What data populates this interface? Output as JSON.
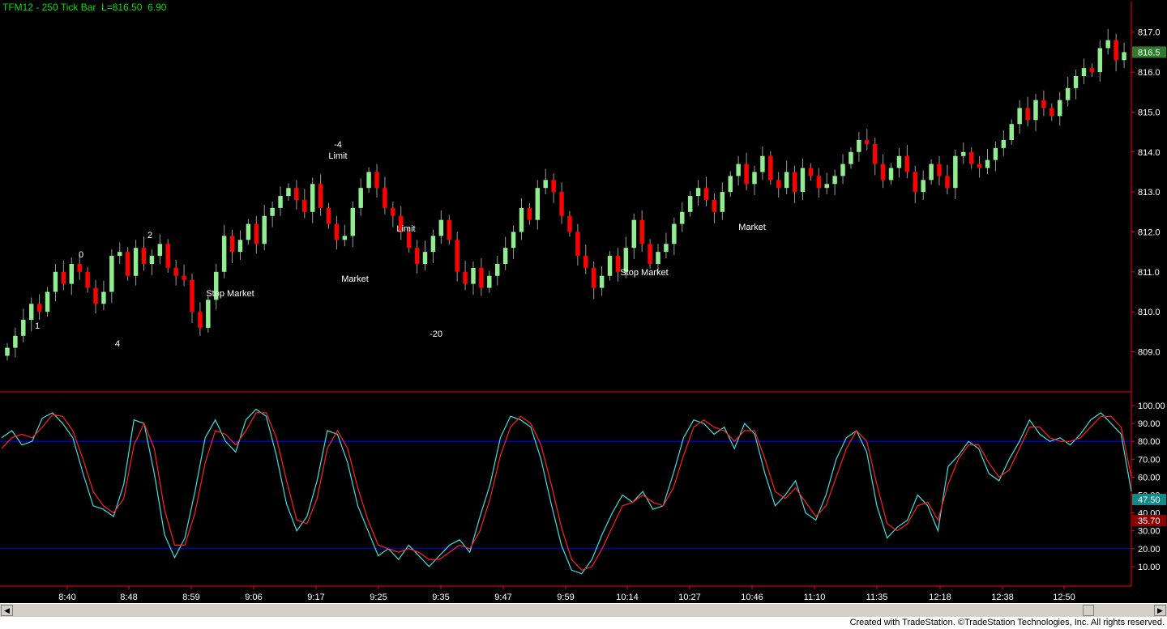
{
  "header": {
    "symbol": "TFM12 - 250 Tick Bar",
    "last_label": "L=816.50",
    "change": "6.90"
  },
  "footer": {
    "text": "Created with TradeStation. ©TradeStation Technologies, Inc. All rights reserved."
  },
  "colors": {
    "up_bar": "#90ee90",
    "down_bar": "#ff0000",
    "fast_line": "#40e0e0",
    "slow_line": "#ff2020",
    "axis": "#ff0000",
    "band": "#0000ff",
    "price_label_bg": "#2e7d2e",
    "osc_fast_bg": "#138a8a",
    "osc_slow_bg": "#8b0000"
  },
  "chart_data": [
    {
      "type": "candlestick",
      "y_ticks": [
        "809.0",
        "810.0",
        "811.0",
        "812.0",
        "813.0",
        "814.0",
        "815.0",
        "816.0",
        "817.0"
      ],
      "ylim": [
        808.2,
        817.4
      ],
      "last_price_label": "816.5",
      "close_series": [
        809.1,
        809.4,
        809.8,
        810.2,
        810.0,
        810.5,
        811.0,
        810.7,
        811.2,
        811.0,
        810.6,
        810.2,
        810.5,
        811.4,
        811.5,
        810.9,
        811.6,
        811.2,
        811.4,
        811.7,
        811.1,
        810.9,
        810.8,
        810.0,
        809.6,
        810.3,
        811.0,
        811.9,
        811.5,
        811.8,
        812.2,
        811.7,
        812.4,
        812.6,
        812.9,
        813.1,
        812.8,
        812.5,
        813.2,
        812.6,
        812.2,
        811.8,
        811.9,
        812.6,
        813.1,
        813.5,
        813.1,
        812.6,
        812.4,
        812.0,
        811.6,
        811.2,
        811.5,
        811.9,
        812.3,
        811.8,
        811.0,
        810.7,
        811.1,
        810.6,
        810.9,
        811.2,
        811.6,
        812.0,
        812.6,
        812.3,
        813.1,
        813.3,
        813.0,
        812.4,
        812.0,
        811.4,
        811.1,
        810.6,
        810.9,
        811.4,
        811.0,
        811.6,
        812.3,
        811.7,
        811.2,
        811.5,
        811.7,
        812.2,
        812.5,
        812.9,
        813.1,
        812.8,
        812.5,
        813.0,
        813.4,
        813.7,
        813.2,
        813.5,
        813.9,
        813.3,
        813.1,
        813.5,
        813.0,
        813.6,
        813.4,
        813.1,
        813.2,
        813.4,
        813.7,
        814.0,
        814.3,
        814.2,
        813.7,
        813.3,
        813.6,
        813.9,
        813.5,
        813.0,
        813.3,
        813.7,
        813.4,
        813.1,
        813.9,
        814.0,
        813.7,
        813.6,
        813.8,
        814.1,
        814.3,
        814.7,
        815.1,
        814.8,
        815.3,
        815.1,
        814.9,
        815.3,
        815.6,
        815.9,
        816.1,
        816.0,
        816.6,
        816.8,
        816.3,
        816.5
      ],
      "annotations": [
        "0",
        "1",
        "2",
        "4",
        "-4",
        "Limit",
        "Stop Market",
        "Market",
        "Limit",
        "Stop Market",
        "Market",
        "-20"
      ]
    },
    {
      "type": "line",
      "y_ticks": [
        "10.00",
        "20.00",
        "30.00",
        "40.00",
        "50.00",
        "60.00",
        "70.00",
        "80.00",
        "90.00",
        "100.00"
      ],
      "ylim": [
        0,
        105
      ],
      "bands": [
        20,
        80
      ],
      "fast_value_label": "47.50",
      "slow_value_label": "35.70",
      "series": [
        {
          "values": [
            82,
            86,
            78,
            80,
            93,
            96,
            90,
            82,
            62,
            44,
            42,
            38,
            56,
            92,
            90,
            62,
            28,
            15,
            26,
            52,
            82,
            92,
            80,
            74,
            92,
            98,
            94,
            72,
            45,
            30,
            38,
            58,
            86,
            84,
            68,
            44,
            30,
            16,
            20,
            14,
            22,
            16,
            10,
            16,
            22,
            25,
            18,
            38,
            56,
            82,
            94,
            92,
            88,
            70,
            45,
            22,
            8,
            6,
            14,
            28,
            40,
            50,
            46,
            52,
            42,
            44,
            62,
            82,
            92,
            90,
            84,
            88,
            76,
            90,
            84,
            62,
            44,
            50,
            58,
            40,
            36,
            50,
            70,
            82,
            86,
            74,
            44,
            26,
            32,
            36,
            50,
            44,
            30,
            66,
            72,
            80,
            76,
            62,
            58,
            70,
            80,
            92,
            84,
            80,
            82,
            78,
            84,
            92,
            96,
            90,
            84,
            52
          ]
        },
        {
          "values": [
            76,
            82,
            84,
            82,
            88,
            95,
            94,
            86,
            70,
            52,
            44,
            40,
            48,
            78,
            90,
            76,
            42,
            22,
            22,
            40,
            68,
            86,
            84,
            78,
            86,
            96,
            96,
            82,
            58,
            36,
            34,
            48,
            76,
            86,
            76,
            54,
            36,
            22,
            20,
            18,
            20,
            18,
            14,
            14,
            18,
            22,
            20,
            30,
            48,
            72,
            88,
            94,
            90,
            78,
            56,
            32,
            14,
            8,
            10,
            20,
            32,
            44,
            46,
            50,
            46,
            44,
            54,
            72,
            88,
            92,
            88,
            86,
            80,
            86,
            86,
            70,
            52,
            48,
            54,
            46,
            38,
            44,
            60,
            76,
            86,
            80,
            56,
            34,
            30,
            34,
            44,
            46,
            36,
            56,
            70,
            78,
            78,
            68,
            60,
            64,
            76,
            88,
            88,
            82,
            80,
            80,
            82,
            88,
            94,
            94,
            88,
            60
          ]
        }
      ]
    }
  ],
  "x_ticks": [
    "8:40",
    "8:48",
    "8:59",
    "9:06",
    "9:17",
    "9:25",
    "9:35",
    "9:47",
    "9:59",
    "10:14",
    "10:27",
    "10:46",
    "11:10",
    "11:35",
    "12:18",
    "12:38",
    "12:50"
  ]
}
